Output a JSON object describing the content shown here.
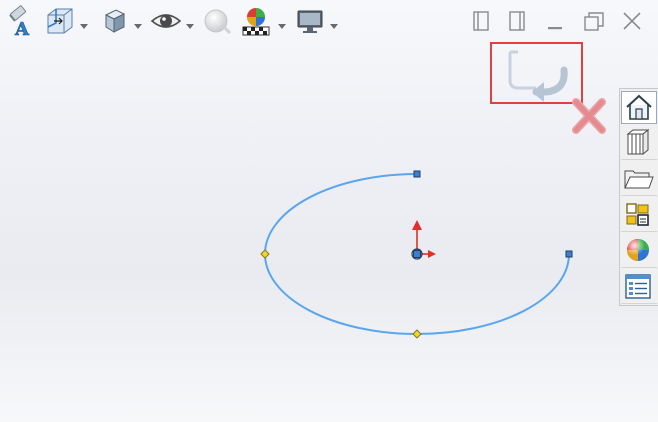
{
  "colors": {
    "ellipse": "#5aa6ee",
    "endpoint_handle": "#3c7fd0",
    "axis_point_handle": "#f2d630",
    "origin_red": "#e0302a",
    "confirm_highlight": "#e0403f",
    "cancel_x": "#e58a8e"
  },
  "toolbar": {
    "items": [
      {
        "name": "view-orientation-icon",
        "has_dropdown": false
      },
      {
        "name": "section-view-icon",
        "has_dropdown": true
      },
      {
        "name": "display-style-icon",
        "has_dropdown": true
      },
      {
        "name": "hide-show-items-icon",
        "has_dropdown": true
      },
      {
        "name": "edit-appearance-icon",
        "has_dropdown": false
      },
      {
        "name": "apply-scene-icon",
        "has_dropdown": true
      },
      {
        "name": "view-settings-icon",
        "has_dropdown": true
      }
    ]
  },
  "window_controls": [
    "restore-left-icon",
    "restore-right-icon",
    "minimize-icon",
    "maximize-icon",
    "close-icon"
  ],
  "confirmation_corner": {
    "exit_sketch_icon": "exit-sketch-icon",
    "cancel_icon": "cancel-x-icon",
    "highlighted": true
  },
  "task_pane": {
    "tabs": [
      {
        "name": "tab-solidworks-resources",
        "icon": "home-icon",
        "active": true
      },
      {
        "name": "tab-design-library",
        "icon": "library-books-icon",
        "active": false
      },
      {
        "name": "tab-file-explorer",
        "icon": "folder-icon",
        "active": false
      },
      {
        "name": "tab-view-palette",
        "icon": "view-palette-icon",
        "active": false
      },
      {
        "name": "tab-appearances",
        "icon": "appearances-sphere-icon",
        "active": false
      },
      {
        "name": "tab-custom-properties",
        "icon": "custom-properties-icon",
        "active": false
      }
    ]
  },
  "sketch": {
    "entity": "partial-ellipse",
    "handles": [
      "center-point",
      "major-axis-endpoint",
      "minor-axis-endpoint",
      "arc-start-point",
      "arc-end-point"
    ]
  }
}
